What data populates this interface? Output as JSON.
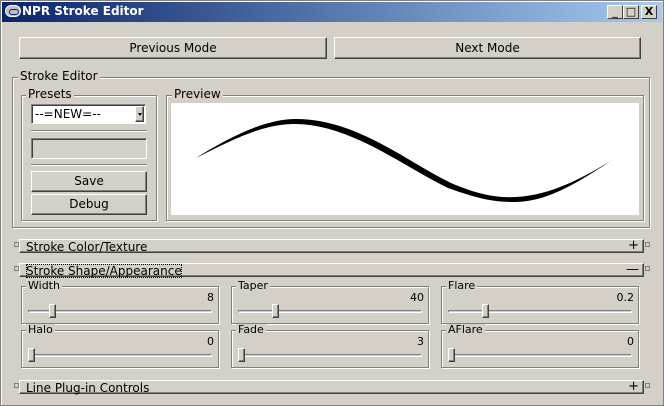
{
  "window": {
    "title": "NPR Stroke Editor",
    "minimize": "_",
    "maximize": "□",
    "close": "X"
  },
  "modes": {
    "previous": "Previous Mode",
    "next": "Next Mode"
  },
  "stroke_editor": {
    "label": "Stroke Editor",
    "presets": {
      "label": "Presets",
      "selected": "--=NEW=--",
      "name_field_value": "",
      "save": "Save",
      "debug": "Debug"
    },
    "preview": {
      "label": "Preview"
    }
  },
  "sections": {
    "color_texture": {
      "label": "Stroke Color/Texture",
      "toggle": "+"
    },
    "shape_appearance": {
      "label": "Stroke Shape/Appearance",
      "toggle": "—"
    },
    "plugin_controls": {
      "label": "Line Plug-in Controls",
      "toggle": "+"
    }
  },
  "sliders": [
    {
      "label": "Width",
      "value": "8",
      "fraction": 0.12
    },
    {
      "label": "Taper",
      "value": "40",
      "fraction": 0.19
    },
    {
      "label": "Flare",
      "value": "0.2",
      "fraction": 0.19
    },
    {
      "label": "Halo",
      "value": "0",
      "fraction": 0.0
    },
    {
      "label": "Fade",
      "value": "3",
      "fraction": 0.0
    },
    {
      "label": "AFlare",
      "value": "0",
      "fraction": 0.0
    }
  ]
}
